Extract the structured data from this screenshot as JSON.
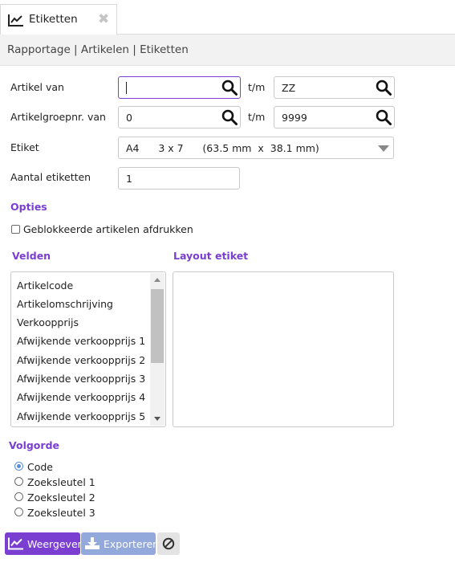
{
  "tab": {
    "label": "Etiketten",
    "close_glyph": "✖"
  },
  "breadcrumb": "Rapportage | Artikelen | Etiketten",
  "form": {
    "artikel_van": {
      "label": "Artikel van",
      "value": ""
    },
    "artikel_tm": {
      "label": "t/m",
      "value": "ZZ"
    },
    "groep_van": {
      "label": "Artikelgroepnr. van",
      "value": "0"
    },
    "groep_tm": {
      "label": "t/m",
      "value": "9999"
    },
    "etiket": {
      "label": "Etiket",
      "value": "A4      3 x 7      (63.5 mm  x  38.1 mm)"
    },
    "aantal": {
      "label": "Aantal etiketten",
      "value": "1"
    }
  },
  "opties": {
    "title": "Opties",
    "geblokkeerd": {
      "label": "Geblokkeerde artikelen afdrukken",
      "checked": false
    }
  },
  "velden": {
    "title": "Velden",
    "items": [
      "Artikelcode",
      "Artikelomschrijving",
      "Verkoopprijs",
      "Afwijkende verkoopprijs 1",
      "Afwijkende verkoopprijs 2",
      "Afwijkende verkoopprijs 3",
      "Afwijkende verkoopprijs 4",
      "Afwijkende verkoopprijs 5"
    ]
  },
  "layout": {
    "title": "Layout etiket"
  },
  "volgorde": {
    "title": "Volgorde",
    "options": [
      "Code",
      "Zoeksleutel 1",
      "Zoeksleutel 2",
      "Zoeksleutel 3"
    ],
    "selected": "Code"
  },
  "actions": {
    "weergeven": "Weergeven",
    "exporteren": "Exporteren"
  },
  "icons": {
    "tab": "chart-line-icon",
    "search": "search-icon",
    "weergeven": "chart-line-icon",
    "exporteren": "download-icon",
    "cancel": "ban-icon"
  },
  "colors": {
    "accent": "#7a3fd1",
    "secondary": "#93a9db",
    "radio": "#5a8fd8"
  }
}
